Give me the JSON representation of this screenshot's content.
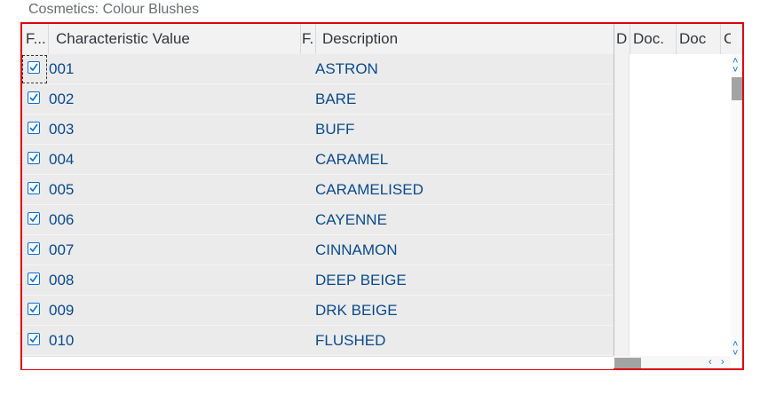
{
  "group": {
    "title": "Cosmetics: Colour Blushes"
  },
  "table": {
    "columns": {
      "flag": "F...",
      "value": "Characteristic Value",
      "flag2": "F.",
      "description": "Description",
      "d": "D",
      "doc1": "Doc.",
      "doc2": "Doc",
      "c": "C"
    },
    "rows": [
      {
        "checked": true,
        "value": "001",
        "description": "ASTRON"
      },
      {
        "checked": true,
        "value": "002",
        "description": "BARE"
      },
      {
        "checked": true,
        "value": "003",
        "description": "BUFF"
      },
      {
        "checked": true,
        "value": "004",
        "description": "CARAMEL"
      },
      {
        "checked": true,
        "value": "005",
        "description": "CARAMELISED"
      },
      {
        "checked": true,
        "value": "006",
        "description": "CAYENNE"
      },
      {
        "checked": true,
        "value": "007",
        "description": "CINNAMON"
      },
      {
        "checked": true,
        "value": "008",
        "description": "DEEP BEIGE"
      },
      {
        "checked": true,
        "value": "009",
        "description": "DRK BEIGE"
      },
      {
        "checked": true,
        "value": "010",
        "description": "FLUSHED"
      }
    ]
  },
  "colors": {
    "frame_border": "#e0000e",
    "link_text": "#0a4a8c",
    "checkbox": "#0a6ed1"
  }
}
